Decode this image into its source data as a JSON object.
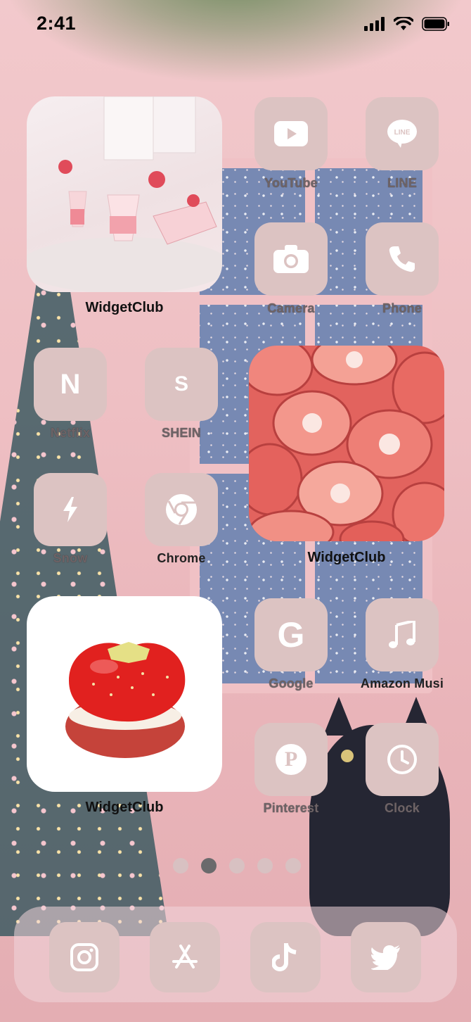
{
  "status": {
    "time": "2:41"
  },
  "widgets": [
    {
      "label": "WidgetClub",
      "image": "strawberry-dessert-cups-photo"
    },
    {
      "label": "WidgetClub",
      "image": "strawberry-pattern-illustration"
    },
    {
      "label": "WidgetClub",
      "image": "strawberry-macaron-photo"
    }
  ],
  "apps": {
    "youtube": {
      "label": "YouTube",
      "icon": "youtube-icon"
    },
    "line": {
      "label": "LINE",
      "icon": "line-icon"
    },
    "camera": {
      "label": "Camera",
      "icon": "camera-icon"
    },
    "phone": {
      "label": "Phone",
      "icon": "phone-icon"
    },
    "netflix": {
      "label": "Netflix",
      "icon": "netflix-icon",
      "glyph": "N"
    },
    "shein": {
      "label": "SHEIN",
      "icon": "shein-icon",
      "glyph": "S"
    },
    "snow": {
      "label": "Snow",
      "icon": "bolt-icon"
    },
    "chrome": {
      "label": "Chrome",
      "icon": "chrome-icon"
    },
    "google": {
      "label": "Google",
      "icon": "google-icon",
      "glyph": "G"
    },
    "amazon_music": {
      "label": "Amazon Musi",
      "icon": "music-note-icon"
    },
    "pinterest": {
      "label": "Pinterest",
      "icon": "pinterest-icon",
      "glyph": "P"
    },
    "clock": {
      "label": "Clock",
      "icon": "clock-icon"
    }
  },
  "page_dots": {
    "count": 5,
    "active_index": 1
  },
  "dock": [
    {
      "name": "Instagram",
      "icon": "instagram-icon"
    },
    {
      "name": "App Store",
      "icon": "app-store-icon"
    },
    {
      "name": "TikTok",
      "icon": "tiktok-icon"
    },
    {
      "name": "Twitter",
      "icon": "twitter-icon"
    }
  ],
  "colors": {
    "tile": "#dcc3c2",
    "glyph": "#ffffff",
    "wallpaper": "#f2c9cc"
  }
}
